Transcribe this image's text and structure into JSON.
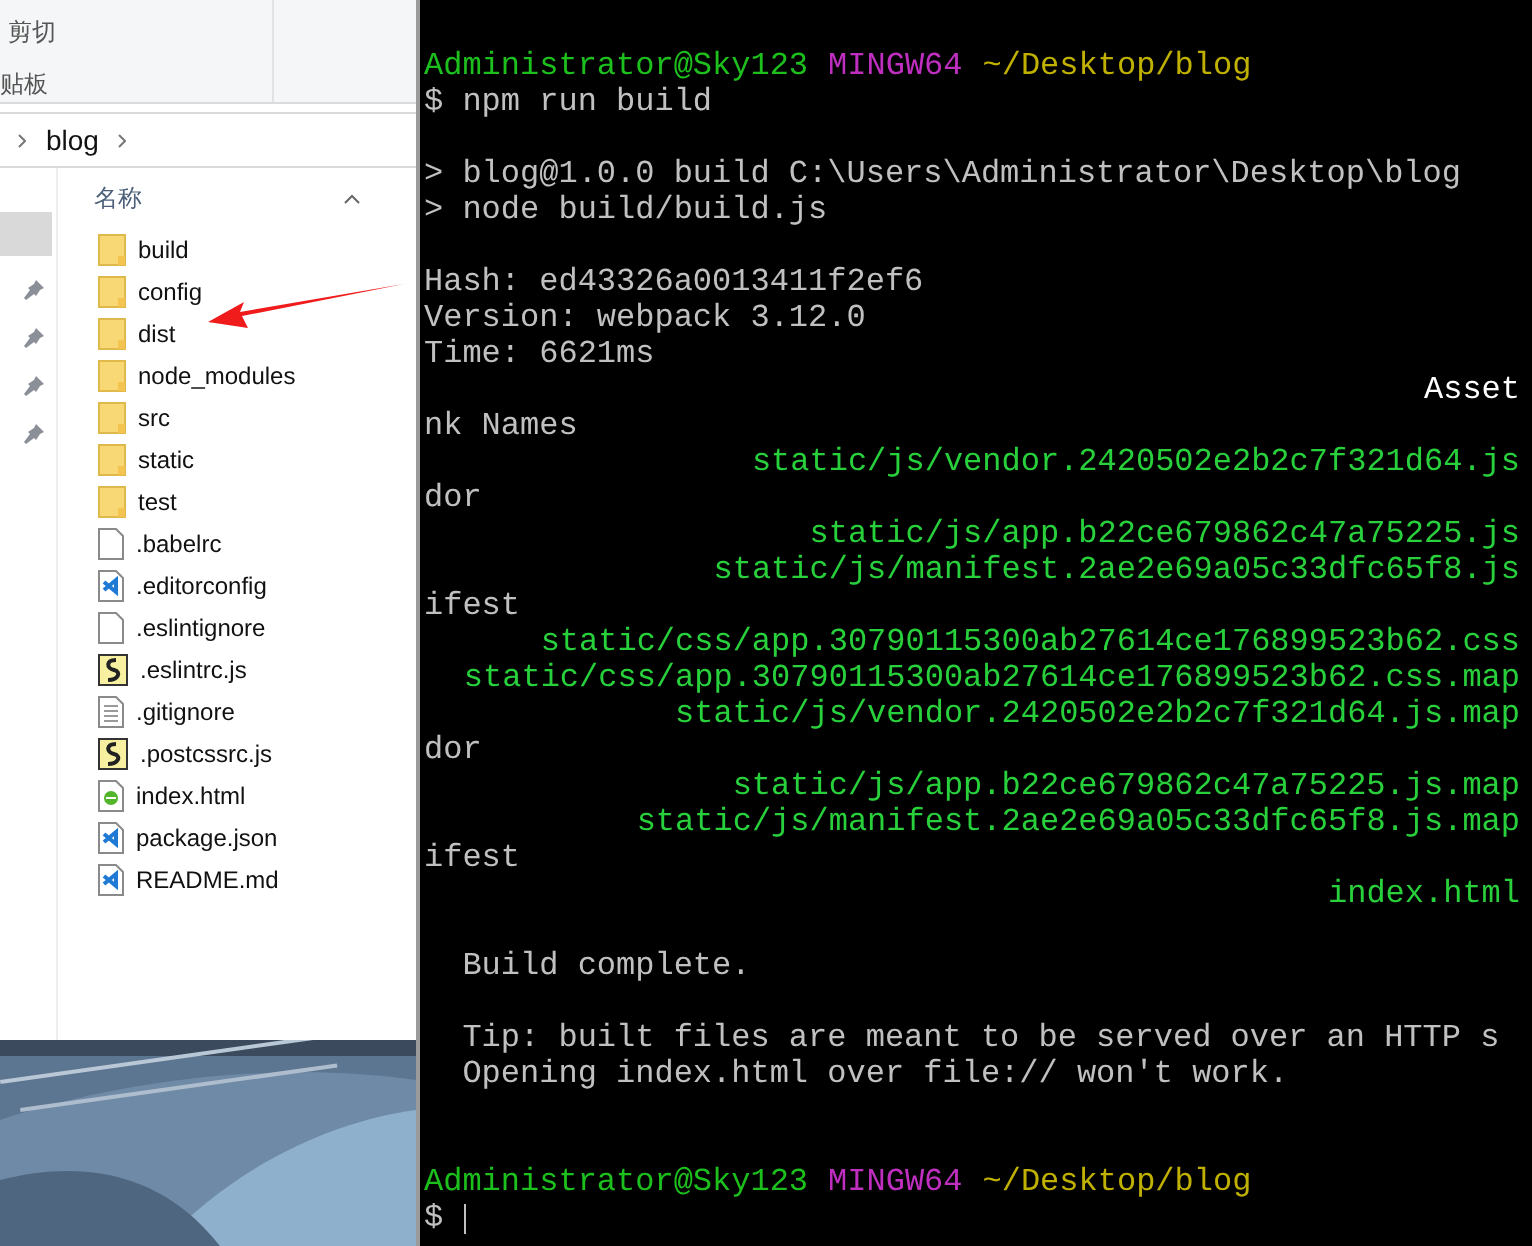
{
  "explorer": {
    "ribbon": [
      "剪切",
      "贴板"
    ],
    "breadcrumb": "blog",
    "column_header": "名称",
    "files": [
      {
        "name": "build",
        "kind": "folder"
      },
      {
        "name": "config",
        "kind": "folder"
      },
      {
        "name": "dist",
        "kind": "folder"
      },
      {
        "name": "node_modules",
        "kind": "folder"
      },
      {
        "name": "src",
        "kind": "folder"
      },
      {
        "name": "static",
        "kind": "folder"
      },
      {
        "name": "test",
        "kind": "folder"
      },
      {
        "name": ".babelrc",
        "kind": "file"
      },
      {
        "name": ".editorconfig",
        "kind": "vscode"
      },
      {
        "name": ".eslintignore",
        "kind": "file"
      },
      {
        "name": ".eslintrc.js",
        "kind": "script"
      },
      {
        "name": ".gitignore",
        "kind": "text"
      },
      {
        "name": ".postcssrc.js",
        "kind": "script"
      },
      {
        "name": "index.html",
        "kind": "html"
      },
      {
        "name": "package.json",
        "kind": "vscode"
      },
      {
        "name": "README.md",
        "kind": "vscode"
      }
    ]
  },
  "terminal": {
    "lines": [
      {
        "kind": "prompt",
        "user": "Administrator@Sky123",
        "system": "MINGW64",
        "path": "~/Desktop/blog"
      },
      {
        "kind": "plain",
        "text": "$ npm run build"
      },
      {
        "kind": "blank"
      },
      {
        "kind": "plain",
        "text": "> blog@1.0.0 build C:\\Users\\Administrator\\Desktop\\blog"
      },
      {
        "kind": "plain",
        "text": "> node build/build.js"
      },
      {
        "kind": "blank"
      },
      {
        "kind": "plain",
        "text": "Hash: ed43326a0013411f2ef6"
      },
      {
        "kind": "plain",
        "text": "Version: webpack 3.12.0"
      },
      {
        "kind": "plain",
        "text": "Time: 6621ms"
      },
      {
        "kind": "header",
        "text": "Asset"
      },
      {
        "kind": "plain",
        "text": "nk Names"
      },
      {
        "kind": "asset",
        "text": "static/js/vendor.2420502e2b2c7f321d64.js"
      },
      {
        "kind": "plain",
        "text": "dor"
      },
      {
        "kind": "asset",
        "text": "static/js/app.b22ce679862c47a75225.js"
      },
      {
        "kind": "asset",
        "text": "static/js/manifest.2ae2e69a05c33dfc65f8.js"
      },
      {
        "kind": "plain",
        "text": "ifest"
      },
      {
        "kind": "asset",
        "text": "static/css/app.30790115300ab27614ce176899523b62.css"
      },
      {
        "kind": "asset",
        "text": "static/css/app.30790115300ab27614ce176899523b62.css.map"
      },
      {
        "kind": "asset",
        "text": "static/js/vendor.2420502e2b2c7f321d64.js.map"
      },
      {
        "kind": "plain",
        "text": "dor"
      },
      {
        "kind": "asset",
        "text": "static/js/app.b22ce679862c47a75225.js.map"
      },
      {
        "kind": "asset",
        "text": "static/js/manifest.2ae2e69a05c33dfc65f8.js.map"
      },
      {
        "kind": "plain",
        "text": "ifest"
      },
      {
        "kind": "asset",
        "text": "index.html"
      },
      {
        "kind": "blank"
      },
      {
        "kind": "plain",
        "text": "  Build complete."
      },
      {
        "kind": "blank"
      },
      {
        "kind": "plain",
        "text": "  Tip: built files are meant to be served over an HTTP s"
      },
      {
        "kind": "plain",
        "text": "  Opening index.html over file:// won't work."
      },
      {
        "kind": "blank"
      },
      {
        "kind": "blank"
      },
      {
        "kind": "prompt",
        "user": "Administrator@Sky123",
        "system": "MINGW64",
        "path": "~/Desktop/blog"
      },
      {
        "kind": "input",
        "text": "$"
      }
    ]
  }
}
